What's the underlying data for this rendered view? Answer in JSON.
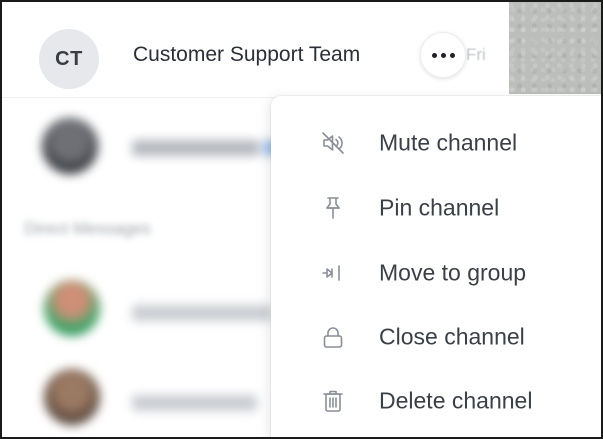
{
  "header": {
    "avatar_initials": "CT",
    "title": "Customer Support Team",
    "time": "Fri"
  },
  "more_button": {
    "icon": "more-horizontal-icon"
  },
  "menu": {
    "items": [
      {
        "label": "Mute channel",
        "icon": "mute-icon"
      },
      {
        "label": "Pin channel",
        "icon": "pin-icon"
      },
      {
        "label": "Move to group",
        "icon": "move-to-group-icon"
      },
      {
        "label": "Close channel",
        "icon": "lock-icon"
      },
      {
        "label": "Delete channel",
        "icon": "trash-icon"
      }
    ]
  },
  "background_list": {
    "section_label": "Direct Messages"
  },
  "colors": {
    "text_primary": "#2b2f36",
    "menu_text": "#3b3f46",
    "avatar_bg": "#e6e8ec",
    "muted": "#c2c6cc"
  }
}
